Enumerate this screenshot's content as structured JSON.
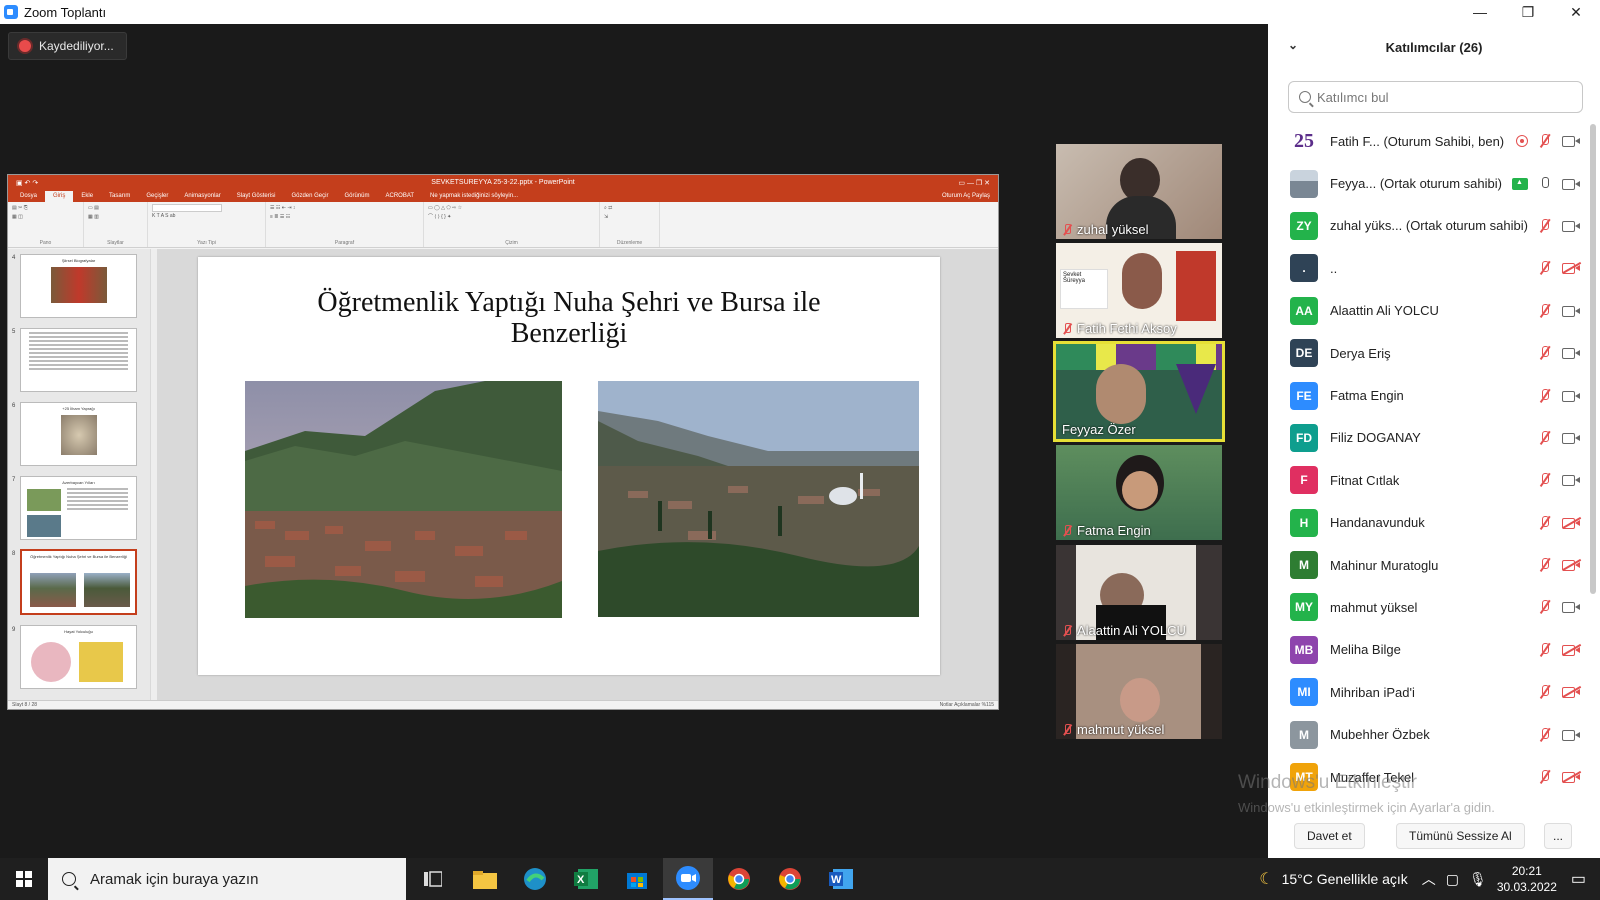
{
  "window": {
    "title": "Zoom Toplantı",
    "controls": {
      "minimize": "—",
      "restore": "❐",
      "close": "✕"
    }
  },
  "recording": {
    "label": "Kaydediliyor..."
  },
  "powerpoint": {
    "doc_title": "SEVKETSUREYYA 25-3-22.pptx - PowerPoint",
    "tabs": [
      "Dosya",
      "Giriş",
      "Ekle",
      "Tasarım",
      "Geçişler",
      "Animasyonlar",
      "Slayt Gösterisi",
      "Gözden Geçir",
      "Görünüm",
      "ACROBAT",
      "Ne yapmak istediğinizi söyleyin..."
    ],
    "tabs_right": "Oturum Aç  Paylaş",
    "ribbon_groups": [
      "Pano",
      "Slaytlar",
      "Yazı Tipi",
      "Paragraf",
      "Çizim",
      "Düzenleme"
    ],
    "thumbnail_numbers": [
      "4",
      "5",
      "6",
      "7",
      "8",
      "9"
    ],
    "thumbnail_titles": [
      "Şiirsel Biografyalar",
      "",
      "+25 İlham Yaprağı",
      "Azerbaycan Yılları",
      "Öğretmenlik Yaptığı Nuha Şehri ve Bursa ile Benzerliği",
      "Hayat Yolculuğu"
    ],
    "slide_title_line1": "Öğretmenlik Yaptığı Nuha Şehri ve Bursa ile",
    "slide_title_line2": "Benzerliği",
    "status_left": "Slayt 8 / 28",
    "status_right": "Notlar   Açıklamalar   %115"
  },
  "video_tiles": [
    {
      "name": "zuhal yüksel",
      "speaking": false
    },
    {
      "name": "Fatih Fethi Aksoy",
      "speaking": false
    },
    {
      "name": "Feyyaz Özer",
      "speaking": true
    },
    {
      "name": "Fatma Engin",
      "speaking": false
    },
    {
      "name": "Alaattin Ali  YOLCU",
      "speaking": false
    },
    {
      "name": "mahmut yüksel",
      "speaking": false
    }
  ],
  "participants": {
    "header": "Katılımcılar (26)",
    "search_placeholder": "Katılımcı bul",
    "list": [
      {
        "initials": "25",
        "color": "#ffffff",
        "name": "Fatih F...  (Oturum Sahibi, ben)",
        "mic": "muted",
        "cam": "on",
        "extra": "rec"
      },
      {
        "initials": "",
        "color": "#b7c3d0",
        "name": "Feyya...  (Ortak oturum sahibi)",
        "mic": "on",
        "cam": "on",
        "extra": "share"
      },
      {
        "initials": "ZY",
        "color": "#23b34b",
        "name": "zuhal yüks...  (Ortak oturum sahibi)",
        "mic": "muted",
        "cam": "on",
        "extra": ""
      },
      {
        "initials": ".",
        "color": "#2f4356",
        "name": "..",
        "mic": "muted",
        "cam": "off",
        "extra": ""
      },
      {
        "initials": "AA",
        "color": "#23b34b",
        "name": "Alaattin Ali  YOLCU",
        "mic": "muted",
        "cam": "on",
        "extra": ""
      },
      {
        "initials": "DE",
        "color": "#2f4356",
        "name": "Derya Eriş",
        "mic": "muted",
        "cam": "on",
        "extra": ""
      },
      {
        "initials": "FE",
        "color": "#2d8cff",
        "name": "Fatma Engin",
        "mic": "muted",
        "cam": "on",
        "extra": ""
      },
      {
        "initials": "FD",
        "color": "#0e9e8e",
        "name": "Filiz DOGANAY",
        "mic": "muted",
        "cam": "on",
        "extra": ""
      },
      {
        "initials": "F",
        "color": "#e02f61",
        "name": "Fitnat Cıtlak",
        "mic": "muted",
        "cam": "on",
        "extra": ""
      },
      {
        "initials": "H",
        "color": "#23b34b",
        "name": "Handanavunduk",
        "mic": "muted",
        "cam": "off",
        "extra": ""
      },
      {
        "initials": "M",
        "color": "#2e7d32",
        "name": "Mahinur Muratoglu",
        "mic": "muted",
        "cam": "off",
        "extra": ""
      },
      {
        "initials": "MY",
        "color": "#23b34b",
        "name": "mahmut yüksel",
        "mic": "muted",
        "cam": "on",
        "extra": ""
      },
      {
        "initials": "MB",
        "color": "#8e44ad",
        "name": "Meliha Bilge",
        "mic": "muted",
        "cam": "off",
        "extra": ""
      },
      {
        "initials": "MI",
        "color": "#2d8cff",
        "name": "Mihriban iPad'i",
        "mic": "muted",
        "cam": "off",
        "extra": ""
      },
      {
        "initials": "M",
        "color": "#8c969e",
        "name": "Mubehher Özbek",
        "mic": "muted",
        "cam": "on",
        "extra": ""
      },
      {
        "initials": "MT",
        "color": "#f0a30a",
        "name": "Muzaffer Tekel",
        "mic": "muted",
        "cam": "off",
        "extra": ""
      }
    ],
    "invite_button": "Davet et",
    "mute_all_button": "Tümünü Sessize Al",
    "more_button": "..."
  },
  "watermark": {
    "line1": "Windows'u Etkinleştir",
    "line2": "Windows'u etkinleştirmek için Ayarlar'a gidin."
  },
  "taskbar": {
    "search_placeholder": "Aramak için buraya yazın",
    "weather": "15°C  Genellikle açık",
    "time": "20:21",
    "date": "30.03.2022"
  }
}
